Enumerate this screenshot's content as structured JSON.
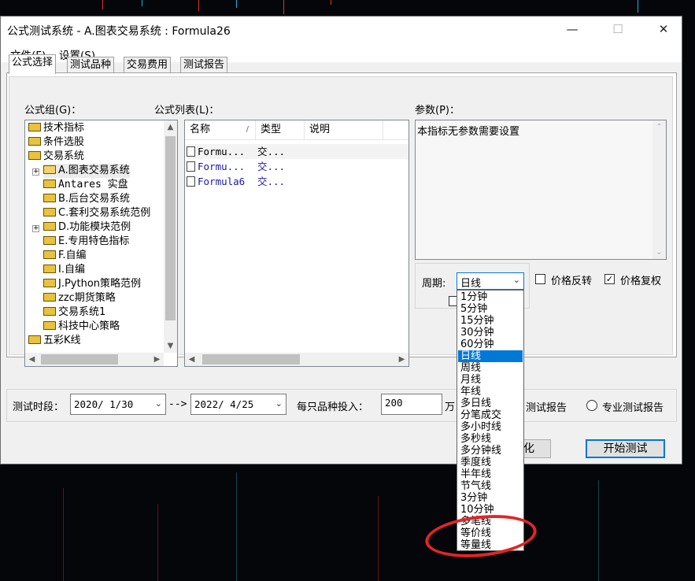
{
  "window": {
    "title": "公式测试系统 - A.图表交易系统 : Formula26",
    "minimize_glyph": "—",
    "maximize_glyph": "☐",
    "close_glyph": "✕"
  },
  "menu": {
    "file": "文件(F)",
    "settings": "设置(S)"
  },
  "tabs": [
    "公式选择",
    "测试品种",
    "交易费用",
    "测试报告"
  ],
  "panel": {
    "group_label": "公式组(G)：",
    "list_label": "公式列表(L)：",
    "params_label": "参数(P)："
  },
  "tree": {
    "items": [
      {
        "text": "技术指标"
      },
      {
        "text": "条件选股"
      },
      {
        "text": "交易系统"
      },
      {
        "text": "A.图表交易系统"
      },
      {
        "text": "Antares 实盘"
      },
      {
        "text": "B.后台交易系统"
      },
      {
        "text": "C.套利交易系统范例"
      },
      {
        "text": "D.功能模块范例"
      },
      {
        "text": "E.专用特色指标"
      },
      {
        "text": "F.自编"
      },
      {
        "text": "I.自编"
      },
      {
        "text": "J.Python策略范例"
      },
      {
        "text": "zzc期货策略"
      },
      {
        "text": "交易系统1"
      },
      {
        "text": "科技中心策略"
      },
      {
        "text": "五彩K线"
      }
    ]
  },
  "formula_list": {
    "columns": [
      "名称",
      "类型",
      "说明"
    ],
    "sort_indicator": "/",
    "rows": [
      {
        "name": "Formu...",
        "type": "交..."
      },
      {
        "name": "Formu...",
        "type": "交..."
      },
      {
        "name": "Formula6",
        "type": "交..."
      }
    ]
  },
  "params": {
    "text": "本指标无参数需要设置"
  },
  "period": {
    "label": "周期:",
    "selected": "日线",
    "options": [
      "1分钟",
      "5分钟",
      "15分钟",
      "30分钟",
      "60分钟",
      "日线",
      "周线",
      "月线",
      "年线",
      "多日线",
      "分笔成交",
      "多小时线",
      "多秒线",
      "多分钟线",
      "季度线",
      "半年线",
      "节气线",
      "3分钟",
      "10分钟",
      "多笔线",
      "等价线",
      "等量线"
    ]
  },
  "checks": {
    "price_reverse": "价格反转",
    "price_adjust": "价格复权"
  },
  "test_period": {
    "label": "测试时段：",
    "start": "2020/ 1/30",
    "arrow": "-->",
    "end": "2022/ 4/25",
    "invest_label": "每只品种投入：",
    "invest_value": "200",
    "unit": "万"
  },
  "report": {
    "report_label": "测试报告",
    "pro_label": "专业测试报告"
  },
  "buttons": {
    "optimize": "化",
    "start": "开始测试"
  },
  "colors": {
    "selection": "#0078d7",
    "annotation": "#e02626",
    "blue_text": "#1a1aa8"
  }
}
